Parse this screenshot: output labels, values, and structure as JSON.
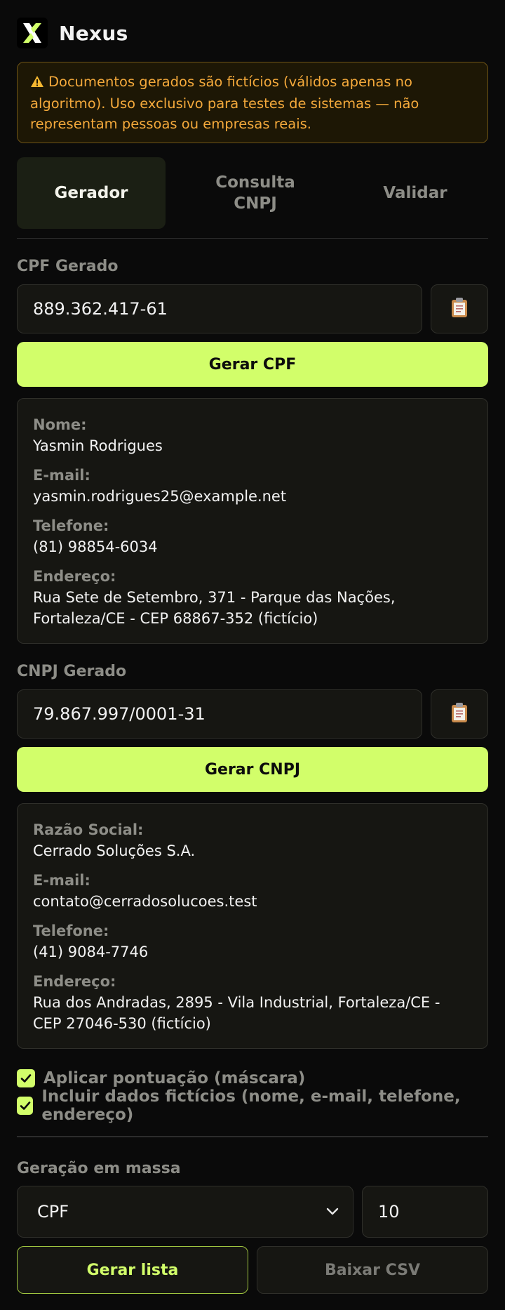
{
  "app": {
    "brand": "Nexus",
    "accent": "#d2fe6a",
    "logo_icon": "x-logo-icon"
  },
  "warning": {
    "icon": "warning-icon",
    "text": "Documentos gerados são fictícios (válidos apenas no algoritmo). Uso exclusivo para testes de sistemas — não representam pessoas ou empresas reais."
  },
  "tabs": [
    {
      "label": "Gerador",
      "active": true
    },
    {
      "label": "Consulta CNPJ",
      "active": false
    },
    {
      "label": "Validar",
      "active": false
    }
  ],
  "cpf": {
    "label": "CPF Gerado",
    "value": "889.362.417-61",
    "generate_label": "Gerar CPF",
    "details": {
      "name_label": "Nome:",
      "name": "Yasmin Rodrigues",
      "email_label": "E-mail:",
      "email": "yasmin.rodrigues25@example.net",
      "phone_label": "Telefone:",
      "phone": "(81) 98854-6034",
      "address_label": "Endereço:",
      "address": "Rua Sete de Setembro, 371 - Parque das Nações, Fortaleza/CE - CEP 68867-352 (fictício)"
    }
  },
  "cnpj": {
    "label": "CNPJ Gerado",
    "value": "79.867.997/0001-31",
    "generate_label": "Gerar CNPJ",
    "details": {
      "name_label": "Razão Social:",
      "name": "Cerrado Soluções S.A.",
      "email_label": "E-mail:",
      "email": "contato@cerradosolucoes.test",
      "phone_label": "Telefone:",
      "phone": "(41) 9084-7746",
      "address_label": "Endereço:",
      "address": "Rua dos Andradas, 2895 - Vila Industrial, Fortaleza/CE - CEP 27046-530 (fictício)"
    }
  },
  "options": {
    "mask_label": "Aplicar pontuação (máscara)",
    "mask_checked": true,
    "fake_data_label": "Incluir dados fictícios (nome, e-mail, telefone, endereço)",
    "fake_data_checked": true
  },
  "bulk": {
    "label": "Geração em massa",
    "type_selected": "CPF",
    "quantity": "10",
    "generate_list_label": "Gerar lista",
    "download_csv_label": "Baixar CSV"
  }
}
